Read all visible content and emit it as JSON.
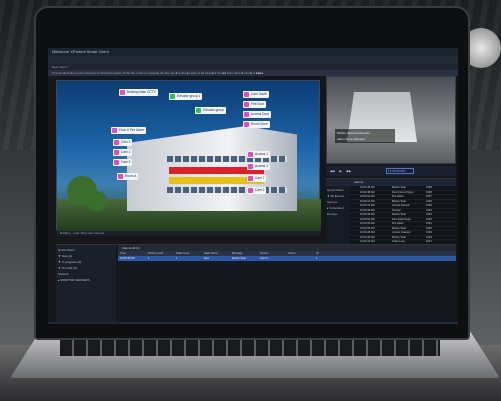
{
  "window": {
    "title": "Milestone XProtect Smart Client"
  },
  "menu": {
    "items": [
      "Live",
      "Playback",
      "Sequence Explorer",
      "Alarm Manager",
      "System Monitor"
    ],
    "active_index": 1
  },
  "toolbar": {
    "view_label": "New View 1",
    "notice": "Prompt: ■ Could you be using the to find the location of the fire or the to evaluate the fire can ■ to the ■ ready to all these■ if it is ■■ from other ■ sites■ is ■■■■"
  },
  "map": {
    "tags": [
      {
        "label": "Building Main CCTV",
        "color": "pink"
      },
      {
        "label": "Elevator group 1",
        "color": "green"
      },
      {
        "label": "Cam South",
        "color": "pink"
      },
      {
        "label": "Elevator group",
        "color": "green"
      },
      {
        "label": "Fire Door",
        "color": "pink"
      },
      {
        "label": "Access Door",
        "color": "pink"
      },
      {
        "label": "Floor 6 Fire Alarm",
        "color": "pink"
      },
      {
        "label": "Room Zone",
        "color": "pink"
      },
      {
        "label": "Cam 3",
        "color": "pink"
      },
      {
        "label": "Cam 2",
        "color": "pink"
      },
      {
        "label": "Cam 5",
        "color": "pink"
      },
      {
        "label": "Access 1",
        "color": "pink"
      },
      {
        "label": "Access 3",
        "color": "pink"
      },
      {
        "label": "Cam 7",
        "color": "pink"
      },
      {
        "label": "Room A",
        "color": "pink"
      },
      {
        "label": "Cam 9",
        "color": "pink"
      }
    ],
    "footer": "Building · Last: Map view interval"
  },
  "camera": {
    "overlay": [
      "Motion detected Elevator",
      "Alarm Zone: Elevator"
    ],
    "time": "12:03:45 PM"
  },
  "alarms": {
    "header": "Alarms",
    "side": [
      "Quick Filters",
      "▼ All Events",
      "Servers",
      "▸ Scheduled Devices"
    ],
    "columns": [
      "Time",
      "Message",
      "ID"
    ],
    "rows": [
      {
        "time": "10:02:45 AM",
        "msg": "Motion Start",
        "id": "1029"
      },
      {
        "time": "10:02:48 AM",
        "msg": "Door Forced Open",
        "id": "1028"
      },
      {
        "time": "10:03:01 AM",
        "msg": "Fire Alarm",
        "id": "1027"
      },
      {
        "time": "10:03:12 AM",
        "msg": "Motion Start",
        "id": "1026"
      },
      {
        "time": "10:03:19 AM",
        "msg": "Access Denied",
        "id": "1025"
      },
      {
        "time": "10:03:30 AM",
        "msg": "Tamper",
        "id": "1024"
      },
      {
        "time": "10:03:44 AM",
        "msg": "Motion Start",
        "id": "1023"
      },
      {
        "time": "10:03:51 AM",
        "msg": "Door Held Open",
        "id": "1022"
      },
      {
        "time": "10:04:02 AM",
        "msg": "Fire Alarm",
        "id": "1021"
      },
      {
        "time": "10:04:15 AM",
        "msg": "Motion Start",
        "id": "1020"
      },
      {
        "time": "10:04:28 AM",
        "msg": "Access Granted",
        "id": "1019"
      },
      {
        "time": "10:04:33 AM",
        "msg": "Motion Start",
        "id": "1018"
      },
      {
        "time": "10:04:41 AM",
        "msg": "Video Loss",
        "id": "1017"
      },
      {
        "time": "10:04:52 AM",
        "msg": "Motion Start",
        "id": "1016"
      },
      {
        "time": "10:05:03 AM",
        "msg": "Fire Alarm",
        "id": "1015"
      },
      {
        "time": "10:05:11 AM",
        "msg": "Motion Start",
        "id": "1014"
      }
    ]
  },
  "lower": {
    "side": [
      "Quick Filters",
      "▼ New (1)",
      "▼ In progress (0)",
      "▼ On hold (0)",
      "Servers",
      "▸ MONITOR SERVERS"
    ],
    "header": "Alarms   All (1)",
    "columns": [
      "Time",
      "Priority Level",
      "State Level",
      "State Name",
      "Message",
      "Source",
      "Owner",
      "ID"
    ],
    "row": [
      "10:02:45 AM",
      "1",
      "1",
      "New",
      "Motion Start",
      "Cam 5",
      "",
      "1"
    ]
  }
}
